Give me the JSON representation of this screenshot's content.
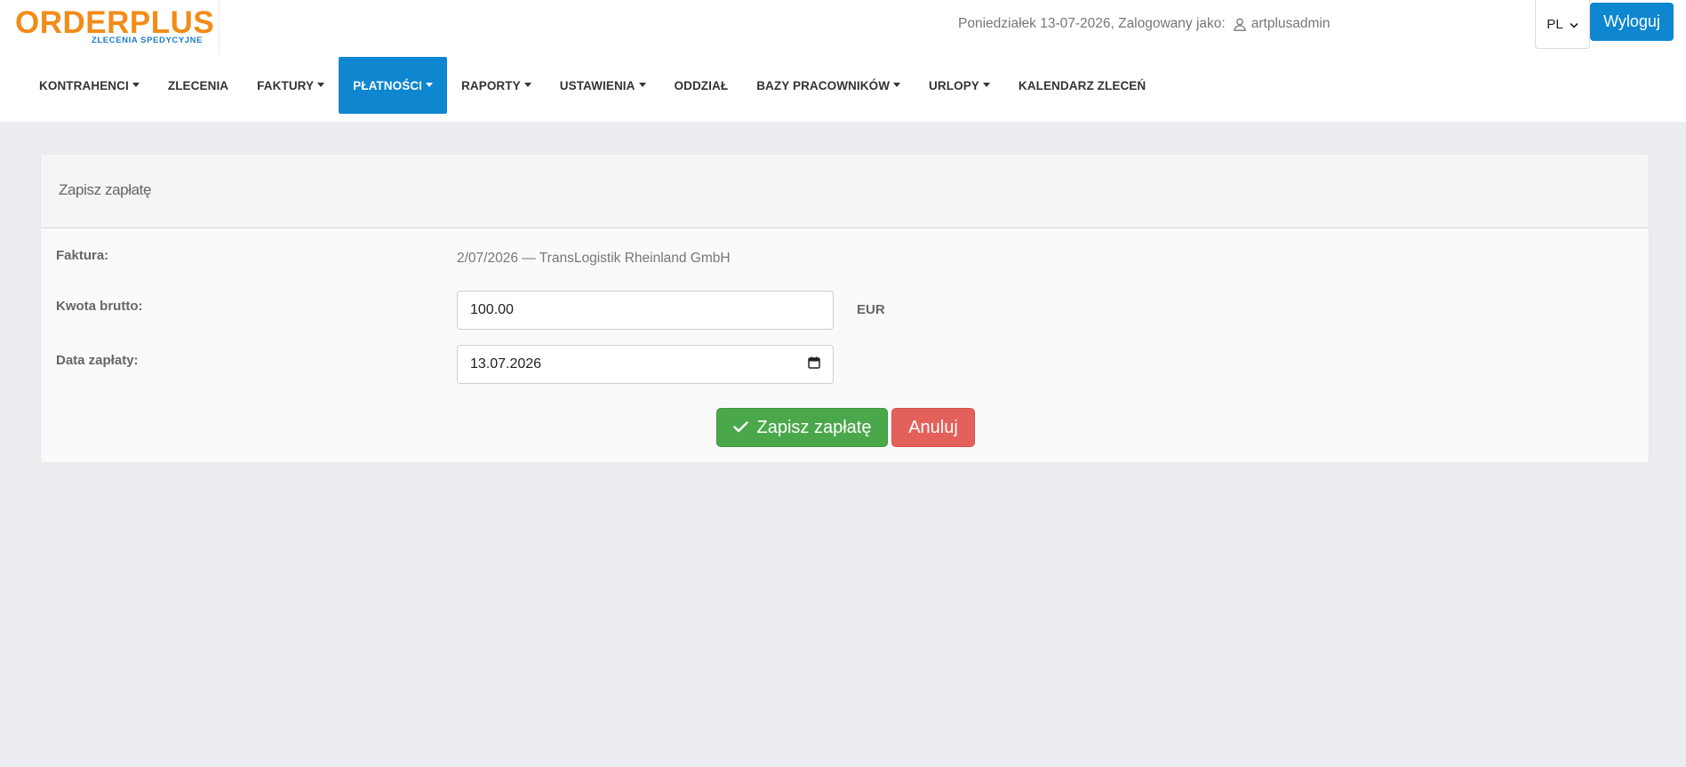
{
  "brand": {
    "name": "ORDERPLUS",
    "tagline": "ZLECENIA SPEDYCYJNE",
    "primary_color": "#f28c18",
    "secondary_color": "#1e7cc8"
  },
  "topbar": {
    "date_text": "Poniedziałek 13-07-2026, Zalogowany jako:",
    "username": "artplusadmin",
    "user_icon": "user-icon",
    "language": "PL",
    "logout_label": "Wyloguj",
    "accent_color": "#0f86d0"
  },
  "nav": {
    "items": [
      {
        "label": "KONTRAHENCI",
        "dropdown": true,
        "active": false
      },
      {
        "label": "ZLECENIA",
        "dropdown": false,
        "active": false
      },
      {
        "label": "FAKTURY",
        "dropdown": true,
        "active": false
      },
      {
        "label": "PŁATNOŚCI",
        "dropdown": true,
        "active": true
      },
      {
        "label": "RAPORTY",
        "dropdown": true,
        "active": false
      },
      {
        "label": "USTAWIENIA",
        "dropdown": true,
        "active": false
      },
      {
        "label": "ODDZIAŁ",
        "dropdown": false,
        "active": false
      },
      {
        "label": "BAZY PRACOWNIKÓW",
        "dropdown": true,
        "active": false
      },
      {
        "label": "URLOPY",
        "dropdown": true,
        "active": false
      },
      {
        "label": "KALENDARZ ZLECEŃ",
        "dropdown": false,
        "active": false
      }
    ]
  },
  "form": {
    "title": "Zapisz zapłatę",
    "invoice_label": "Faktura:",
    "invoice_value": "2/07/2026 — TransLogistik Rheinland GmbH",
    "amount_label": "Kwota brutto:",
    "amount_value": "100.00",
    "currency": "EUR",
    "date_label": "Data zapłaty:",
    "date_value": "13.07.2026",
    "save_label": "Zapisz zapłatę",
    "cancel_label": "Anuluj",
    "save_color": "#4aa84a",
    "cancel_color": "#e4605a"
  }
}
